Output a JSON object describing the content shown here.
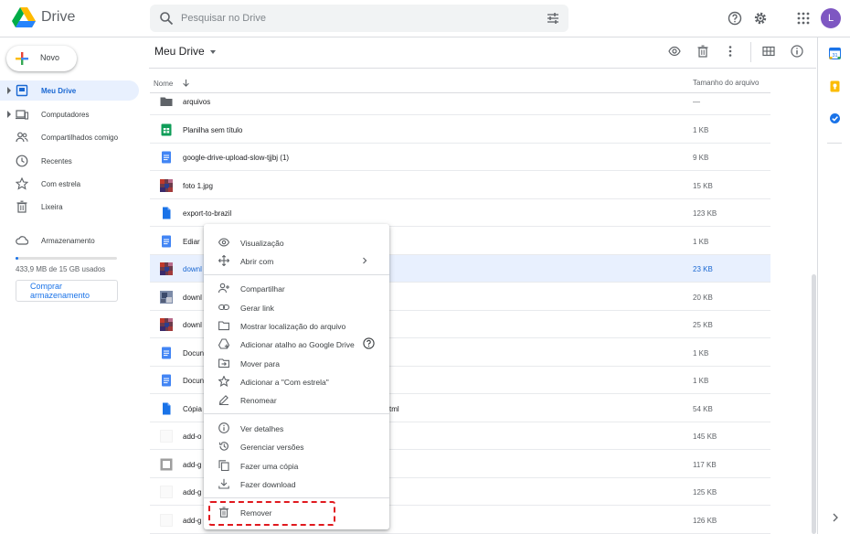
{
  "header": {
    "brand": "Drive",
    "search_placeholder": "Pesquisar no Drive",
    "avatar_letter": "L"
  },
  "sidebar": {
    "new_label": "Novo",
    "items": [
      {
        "label": "Meu Drive",
        "icon": "my-drive-icon",
        "active": true
      },
      {
        "label": "Computadores",
        "icon": "computers-icon"
      },
      {
        "label": "Compartilhados comigo",
        "icon": "shared-icon"
      },
      {
        "label": "Recentes",
        "icon": "clock-icon"
      },
      {
        "label": "Com estrela",
        "icon": "star-icon"
      },
      {
        "label": "Lixeira",
        "icon": "trash-icon"
      }
    ],
    "storage_label": "Armazenamento",
    "storage_used": "433,9 MB de 15 GB usados",
    "storage_fraction": 0.029,
    "buy_label": "Comprar armazenamento"
  },
  "main": {
    "title": "Meu Drive",
    "col_name": "Nome",
    "col_size": "Tamanho do arquivo",
    "rows": [
      {
        "name": "arquivos",
        "size": "—",
        "type": "folder"
      },
      {
        "name": "Planilha sem título",
        "size": "1 KB",
        "type": "sheet"
      },
      {
        "name": "google-drive-upload-slow-tjjbj (1)",
        "size": "9 KB",
        "type": "doc"
      },
      {
        "name": "foto 1.jpg",
        "size": "15 KB",
        "type": "image"
      },
      {
        "name": "export-to-brazil",
        "size": "123 KB",
        "type": "file"
      },
      {
        "name": "Ediar",
        "size": "1 KB",
        "type": "doc"
      },
      {
        "name": "downl",
        "size": "23 KB",
        "type": "image",
        "selected": true
      },
      {
        "name": "downl",
        "size": "20 KB",
        "type": "image2"
      },
      {
        "name": "downl",
        "size": "25 KB",
        "type": "image"
      },
      {
        "name": "Docun",
        "size": "1 KB",
        "type": "doc"
      },
      {
        "name": "Docun",
        "size": "1 KB",
        "type": "doc"
      },
      {
        "name": "Cópia",
        "size": "54 KB",
        "type": "file",
        "extra": "tml"
      },
      {
        "name": "add-o",
        "size": "145 KB",
        "type": "blank"
      },
      {
        "name": "add-g",
        "size": "117 KB",
        "type": "gray"
      },
      {
        "name": "add-g",
        "size": "125 KB",
        "type": "blank"
      },
      {
        "name": "add-g",
        "size": "126 KB",
        "type": "blank"
      }
    ]
  },
  "context_menu": {
    "items": [
      {
        "label": "Visualização",
        "icon": "eye-icon"
      },
      {
        "label": "Abrir com",
        "icon": "open-with-icon",
        "submenu": true
      },
      {
        "label": "Compartilhar",
        "icon": "share-person-icon"
      },
      {
        "label": "Gerar link",
        "icon": "link-icon"
      },
      {
        "label": "Mostrar localização do arquivo",
        "icon": "folder-icon"
      },
      {
        "label": "Adicionar atalho ao Google Drive",
        "icon": "shortcut-icon",
        "help": true
      },
      {
        "label": "Mover para",
        "icon": "move-icon"
      },
      {
        "label": "Adicionar a \"Com estrela\"",
        "icon": "star-icon"
      },
      {
        "label": "Renomear",
        "icon": "pencil-icon"
      },
      {
        "label": "Ver detalhes",
        "icon": "info-icon"
      },
      {
        "label": "Gerenciar versões",
        "icon": "history-icon"
      },
      {
        "label": "Fazer uma cópia",
        "icon": "copy-icon"
      },
      {
        "label": "Fazer download",
        "icon": "download-icon"
      },
      {
        "label": "Remover",
        "icon": "trash-icon"
      }
    ]
  },
  "colors": {
    "accent": "#1a73e8",
    "selected_bg": "#e8f0fe",
    "highlight": "#e0191e"
  }
}
